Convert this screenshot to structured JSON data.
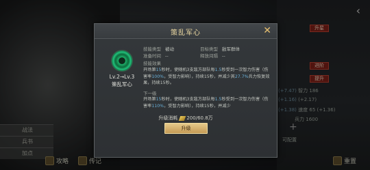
{
  "background": {
    "right_buttons": [
      "升星",
      "进阶",
      "提升"
    ],
    "stats": [
      {
        "label": "(+7.47)",
        "value": "智力",
        "extra": "186"
      },
      {
        "label": "(+1.16)",
        "value": "",
        "extra": "(+2.17)"
      },
      {
        "label": "(+1.38)",
        "value": "速度",
        "extra": "65 (+1.36)"
      },
      {
        "label": "",
        "value": "兵力",
        "extra": "1600"
      }
    ],
    "left_tabs": [
      "战法",
      "兵书",
      "加点"
    ],
    "bottom_items": [
      "攻略",
      "传记",
      "重置"
    ],
    "plus_label": "可配置"
  },
  "modal": {
    "title": "策乱军心",
    "close_symbol": "✕",
    "skill": {
      "level": "Lv.2→Lv.3",
      "name": "策乱军心"
    },
    "info": {
      "skill_type_label": "技能类型",
      "skill_type_value": "被动",
      "target_type_label": "目标类型",
      "target_type_value": "敌军群体",
      "prep_time_label": "准备时间",
      "prep_time_value": "--",
      "release_rate_label": "释放间隔",
      "release_rate_value": "--",
      "effect_label": "技能效果"
    },
    "current_effect": {
      "p1": "开场第",
      "h1": "15",
      "p2": "秒时，使随机3支敌方部队每",
      "h2": "1.5",
      "p3": "秒受到一次智力伤害（伤害率",
      "h3": "100%",
      "p4": "，受智力影响），持续15秒，并减少其",
      "h4": "27.7%",
      "p5": "兵力恢复效果，持续15秒。"
    },
    "next_level_label": "下一级",
    "next_effect": {
      "p1": "开场第",
      "h1": "15",
      "p2": "秒时，使随机3支敌方部队每",
      "h2": "1.5",
      "p3": "秒受到一次智力伤害（伤害率",
      "h3": "110%",
      "p4": "，受智力影响），持续15秒，并减少"
    },
    "cost_label": "升级消耗",
    "cost_value": "200/60.8万",
    "upgrade_label": "升级"
  },
  "colors": {
    "title_gold": "#e8d6a0",
    "highlight_blue": "#6ab0d8",
    "button_gold": "#d9b56f"
  }
}
